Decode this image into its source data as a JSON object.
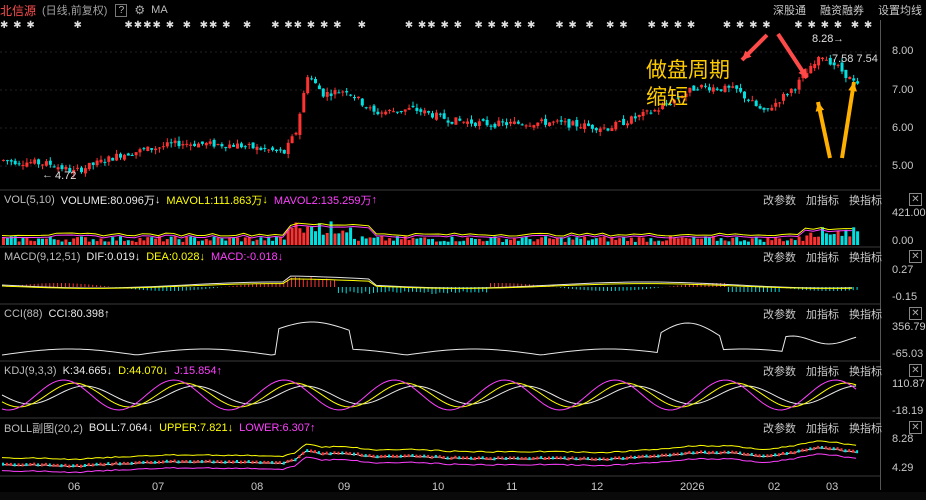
{
  "header": {
    "stock_name": "北信源",
    "period": "(日线,前复权)",
    "help": "?",
    "ma": "MA",
    "right_links": [
      "深股通",
      "融资融券",
      "设置均线"
    ]
  },
  "main_chart": {
    "y_labels": [
      "8.00",
      "7.00",
      "6.00",
      "5.00"
    ],
    "high_label": "8.28",
    "low_label": "4.72",
    "price_tag": "7.58 7.54",
    "annotation": [
      "做盘周期",
      "缩短"
    ]
  },
  "panels": {
    "tools": [
      "改参数",
      "加指标",
      "换指标"
    ],
    "vol": {
      "name": "VOL(5,10)",
      "v1": "VOLUME:80.096万",
      "v2": "MAVOL1:111.863万",
      "v3": "MAVOL2:135.259万",
      "y_top": "421.00",
      "y_bot": "0.00"
    },
    "macd": {
      "name": "MACD(9,12,51)",
      "v1": "DIF:0.019",
      "v2": "DEA:0.028",
      "v3": "MACD:-0.018",
      "y_top": "0.27",
      "y_bot": "-0.15"
    },
    "cci": {
      "name": "CCI(88)",
      "v1": "CCI:80.398",
      "y_top": "356.79",
      "y_bot": "-65.03"
    },
    "kdj": {
      "name": "KDJ(9,3,3)",
      "v1": "K:34.665",
      "v2": "D:44.070",
      "v3": "J:15.854",
      "y_top": "110.87",
      "y_bot": "-18.19"
    },
    "boll": {
      "name": "BOLL副图(20,2)",
      "v1": "BOLL:7.064",
      "v2": "UPPER:7.821",
      "v3": "LOWER:6.307",
      "y_top": "8.28",
      "y_bot": "4.29"
    }
  },
  "x_axis": [
    "06",
    "07",
    "08",
    "09",
    "10",
    "11",
    "12",
    "2026",
    "02",
    "03"
  ],
  "colors": {
    "up": "#ff3232",
    "down": "#00e0e0",
    "annotation": "#ffcc00",
    "arrow_red": "#ff4a4a",
    "arrow_yellow": "#ffb000"
  }
}
